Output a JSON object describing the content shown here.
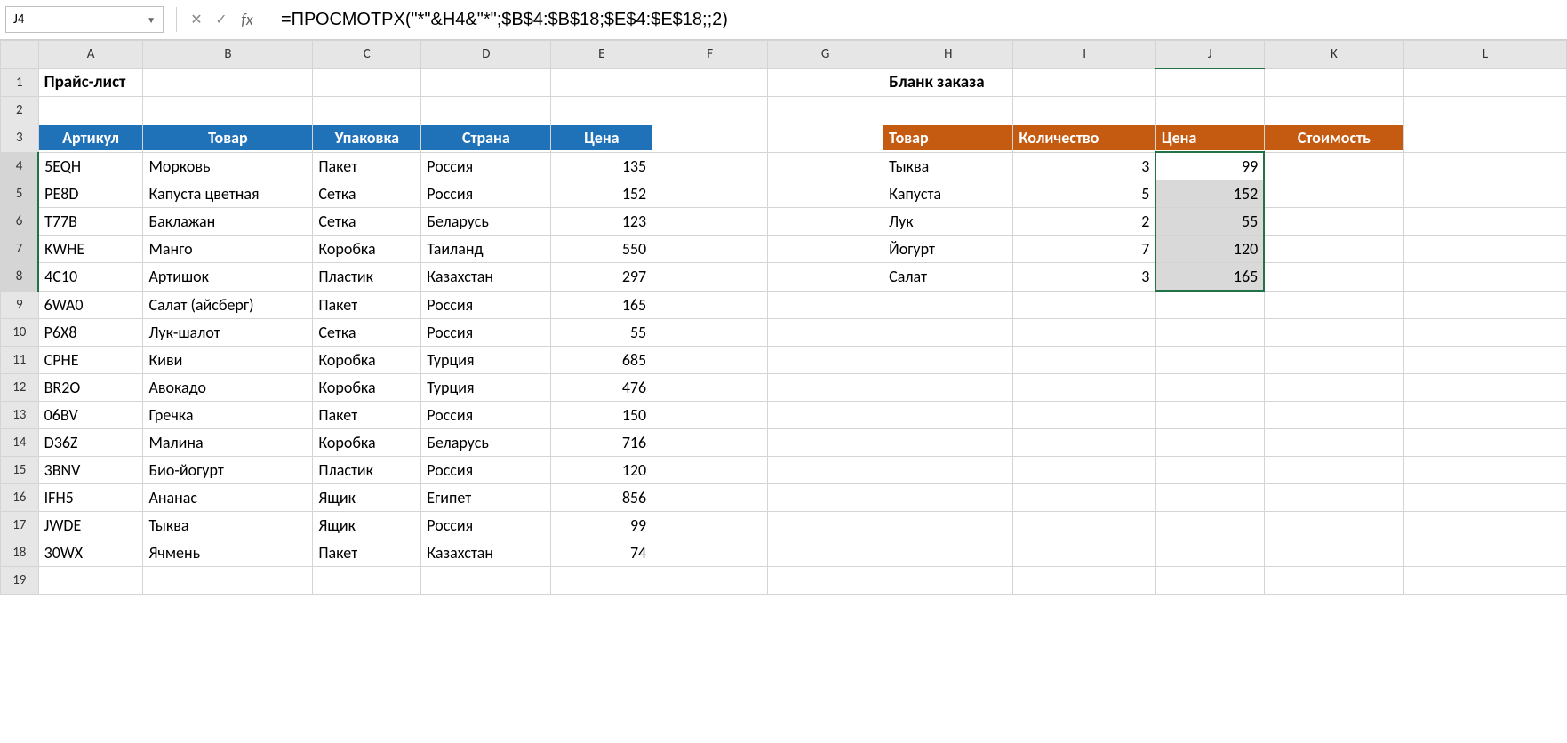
{
  "nameBox": "J4",
  "formula": "=ПРОСМОТРX(\"*\"&H4&\"*\";$B$4:$B$18;$E$4:$E$18;;2)",
  "columns": [
    "A",
    "B",
    "C",
    "D",
    "E",
    "F",
    "G",
    "H",
    "I",
    "J",
    "K",
    "L"
  ],
  "sectionTitles": {
    "price": "Прайс-лист",
    "order": "Бланк заказа"
  },
  "priceHeaders": {
    "A": "Артикул",
    "B": "Товар",
    "C": "Упаковка",
    "D": "Страна",
    "E": "Цена"
  },
  "orderHeaders": {
    "H": "Товар",
    "I": "Количество",
    "J": "Цена",
    "K": "Стоимость"
  },
  "priceRows": [
    {
      "A": "5EQH",
      "B": "Морковь",
      "C": "Пакет",
      "D": "Россия",
      "E": 135
    },
    {
      "A": "PE8D",
      "B": "Капуста цветная",
      "C": "Сетка",
      "D": "Россия",
      "E": 152
    },
    {
      "A": "T77B",
      "B": "Баклажан",
      "C": "Сетка",
      "D": "Беларусь",
      "E": 123
    },
    {
      "A": "KWHE",
      "B": "Манго",
      "C": "Коробка",
      "D": "Таиланд",
      "E": 550
    },
    {
      "A": "4C10",
      "B": "Артишок",
      "C": "Пластик",
      "D": "Казахстан",
      "E": 297
    },
    {
      "A": "6WA0",
      "B": "Салат (айсберг)",
      "C": "Пакет",
      "D": "Россия",
      "E": 165
    },
    {
      "A": "P6X8",
      "B": "Лук-шалот",
      "C": "Сетка",
      "D": "Россия",
      "E": 55
    },
    {
      "A": "CPHE",
      "B": "Киви",
      "C": "Коробка",
      "D": "Турция",
      "E": 685
    },
    {
      "A": "BR2O",
      "B": "Авокадо",
      "C": "Коробка",
      "D": "Турция",
      "E": 476
    },
    {
      "A": "06BV",
      "B": "Гречка",
      "C": "Пакет",
      "D": "Россия",
      "E": 150
    },
    {
      "A": "D36Z",
      "B": "Малина",
      "C": "Коробка",
      "D": "Беларусь",
      "E": 716
    },
    {
      "A": "3BNV",
      "B": "Био-йогурт",
      "C": "Пластик",
      "D": "Россия",
      "E": 120
    },
    {
      "A": "IFH5",
      "B": "Ананас",
      "C": "Ящик",
      "D": "Египет",
      "E": 856
    },
    {
      "A": "JWDE",
      "B": "Тыква",
      "C": "Ящик",
      "D": "Россия",
      "E": 99
    },
    {
      "A": "30WX",
      "B": "Ячмень",
      "C": "Пакет",
      "D": "Казахстан",
      "E": 74
    }
  ],
  "orderRows": [
    {
      "H": "Тыква",
      "I": 3,
      "J": 99
    },
    {
      "H": "Капуста",
      "I": 5,
      "J": 152
    },
    {
      "H": "Лук",
      "I": 2,
      "J": 55
    },
    {
      "H": "Йогурт",
      "I": 7,
      "J": 120
    },
    {
      "H": "Салат",
      "I": 3,
      "J": 165
    }
  ],
  "selection": {
    "col": "J",
    "rowStart": 4,
    "rowEnd": 8
  }
}
